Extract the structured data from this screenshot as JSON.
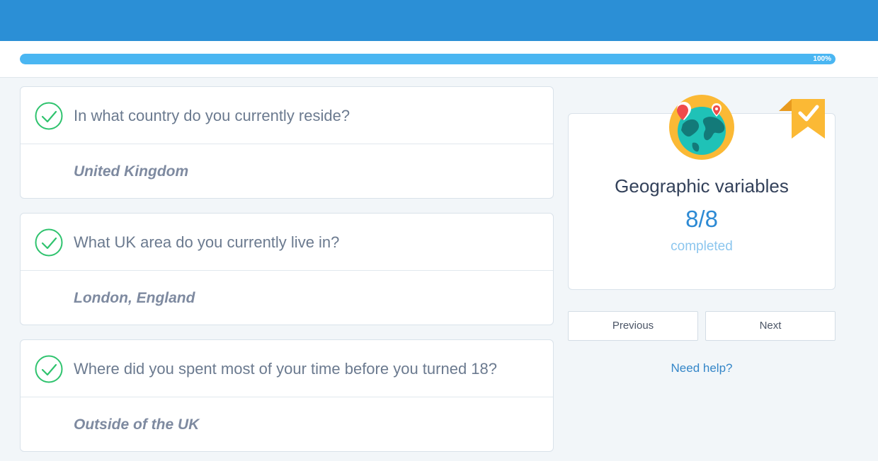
{
  "progress": {
    "label": "100%",
    "value": 1.0
  },
  "questions": [
    {
      "question": "In what country do you currently reside?",
      "answer": "United Kingdom"
    },
    {
      "question": "What UK area do you currently live in?",
      "answer": "London, England"
    },
    {
      "question": "Where did you spent most of your time before you turned 18?",
      "answer": "Outside of the UK"
    }
  ],
  "summary": {
    "title": "Geographic variables",
    "count": "8/8",
    "status": "completed",
    "icons": [
      "globe-icon",
      "ribbon-check-badge-icon"
    ]
  },
  "navigation": {
    "previous_label": "Previous",
    "next_label": "Next"
  },
  "help": {
    "label": "Need help?"
  },
  "colors": {
    "header": "#2b8fd6",
    "progress": "#4ab6f2",
    "check": "#2fc36e",
    "accent": "#2d8ad4",
    "badge": "#fbb935"
  }
}
